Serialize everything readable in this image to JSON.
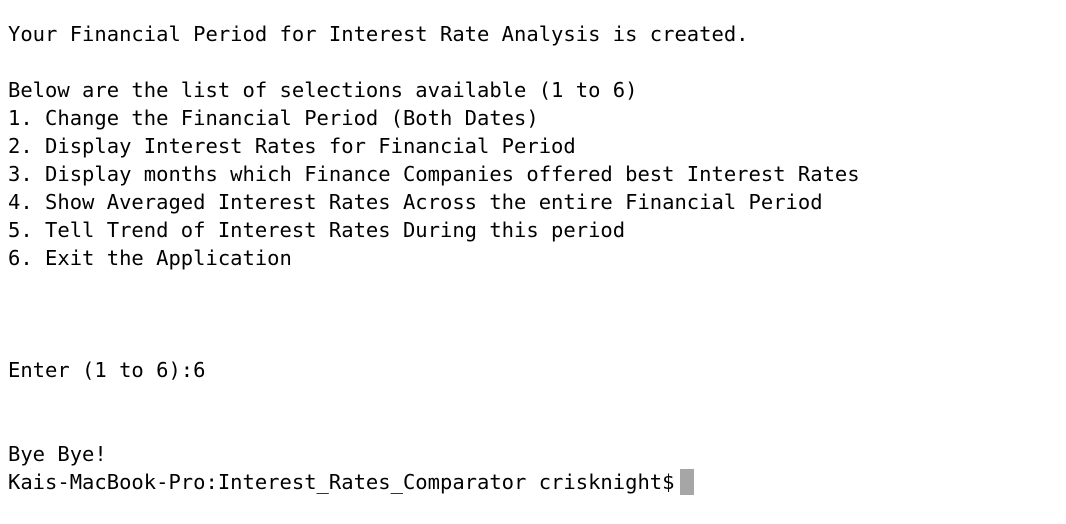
{
  "terminal": {
    "lines": {
      "status_message": "Your Financial Period for Interest Rate Analysis is created.",
      "menu_header": "Below are the list of selections available (1 to 6)",
      "option_1": "1. Change the Financial Period (Both Dates)",
      "option_2": "2. Display Interest Rates for Financial Period",
      "option_3": "3. Display months which Finance Companies offered best Interest Rates",
      "option_4": "4. Show Averaged Interest Rates Across the entire Financial Period",
      "option_5": "5. Tell Trend of Interest Rates During this period",
      "option_6": "6. Exit the Application",
      "input_prompt": "Enter (1 to 6):6",
      "goodbye": "Bye Bye!",
      "shell_prompt": "Kais-MacBook-Pro:Interest_Rates_Comparator crisknight$"
    },
    "colors": {
      "background": "#ffffff",
      "text": "#000000",
      "cursor": "#a6a6a6"
    }
  }
}
